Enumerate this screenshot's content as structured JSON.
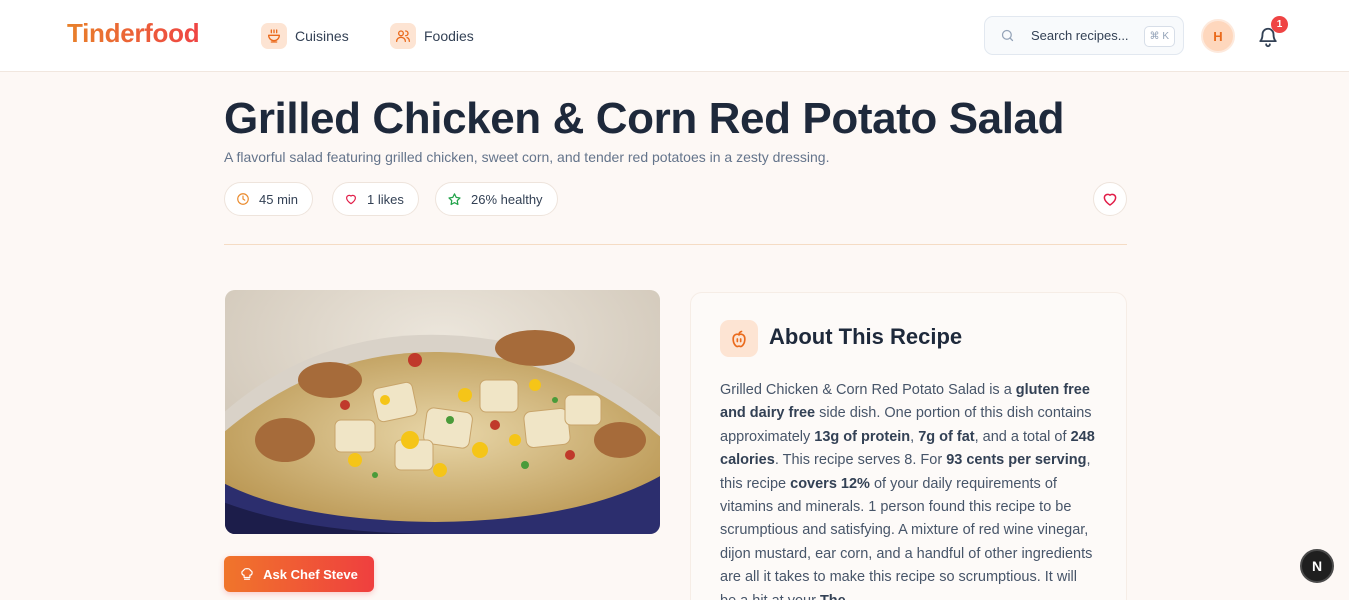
{
  "header": {
    "logo": "Tinderfood",
    "nav": [
      {
        "label": "Cuisines",
        "icon": "bowl-icon"
      },
      {
        "label": "Foodies",
        "icon": "users-icon"
      }
    ],
    "search": {
      "placeholder": "Search recipes...",
      "shortcut": "⌘ K"
    },
    "avatar_initial": "H",
    "notification_count": "1"
  },
  "recipe": {
    "title": "Grilled Chicken & Corn Red Potato Salad",
    "subtitle": "A flavorful salad featuring grilled chicken, sweet corn, and tender red potatoes in a zesty dressing.",
    "stats": {
      "time": "45 min",
      "likes": "1 likes",
      "healthy": "26% healthy"
    },
    "ask_button": "Ask Chef Steve"
  },
  "about": {
    "title": "About This Recipe",
    "segments": [
      {
        "t": "Grilled Chicken & Corn Red Potato Salad is a ",
        "b": false
      },
      {
        "t": "gluten free and dairy free",
        "b": true
      },
      {
        "t": " side dish. One portion of this dish contains approximately ",
        "b": false
      },
      {
        "t": "13g of protein",
        "b": true
      },
      {
        "t": ", ",
        "b": false
      },
      {
        "t": "7g of fat",
        "b": true
      },
      {
        "t": ", and a total of ",
        "b": false
      },
      {
        "t": "248 calories",
        "b": true
      },
      {
        "t": ". This recipe serves 8. For ",
        "b": false
      },
      {
        "t": "93 cents per serving",
        "b": true
      },
      {
        "t": ", this recipe ",
        "b": false
      },
      {
        "t": "covers 12%",
        "b": true
      },
      {
        "t": " of your daily requirements of vitamins and minerals. 1 person found this recipe to be scrumptious and satisfying. A mixture of red wine vinegar, dijon mustard, ear corn, and a handful of other ingredients are all it takes to make this recipe so scrumptious. It will be a hit at your ",
        "b": false
      },
      {
        "t": "The",
        "b": true
      }
    ]
  },
  "dev_badge": "N",
  "colors": {
    "brand_start": "#e8812a",
    "brand_end": "#ef4444",
    "accent_bg": "#fde4d3"
  }
}
